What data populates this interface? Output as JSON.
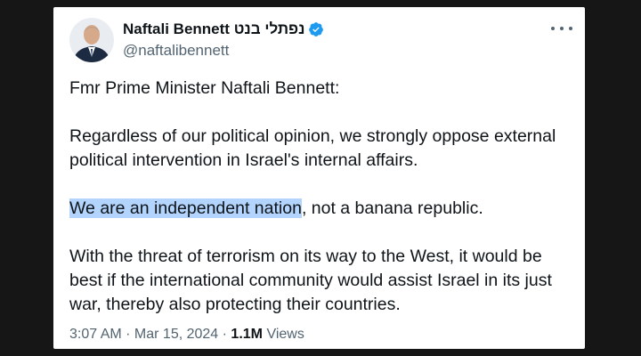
{
  "tweet": {
    "author": {
      "display_name": "Naftali Bennett נפתלי בנט",
      "handle": "@naftalibennett",
      "verified": true,
      "verified_color": "#1d9bf0"
    },
    "body": {
      "p1": "Fmr Prime Minister Naftali Bennett:",
      "p2": "Regardless of our political opinion, we strongly oppose external political intervention in Israel's internal affairs.",
      "p3_highlighted": "We are an independent nation",
      "p3_rest": ", not a banana republic.",
      "p4": "With the threat of terrorism on its way to the West, it would be best if the international community would assist Israel in its just war, thereby also protecting their countries."
    },
    "timestamp": "3:07 AM · Mar 15, 2024 · ",
    "views_count": "1.1M",
    "views_label": " Views",
    "highlight_color": "#b3d4fc"
  },
  "icons": {
    "avatar": "profile-photo",
    "verified": "verified-badge-icon",
    "more": "more-options-icon"
  }
}
